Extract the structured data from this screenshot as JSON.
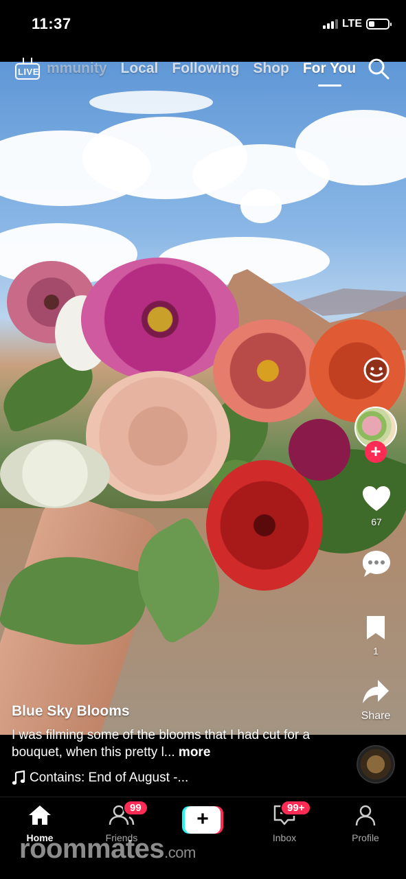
{
  "status_bar": {
    "time": "11:37",
    "network": "LTE"
  },
  "top_nav": {
    "live_label": "LIVE",
    "tabs": [
      {
        "label": "mmunity",
        "active": false
      },
      {
        "label": "Local",
        "active": false
      },
      {
        "label": "Following",
        "active": false
      },
      {
        "label": "Shop",
        "active": false
      },
      {
        "label": "For You",
        "active": true
      }
    ],
    "search_icon": "search-icon"
  },
  "right_rail": {
    "like_count": "67",
    "bookmark_count": "1",
    "share_label": "Share"
  },
  "caption": {
    "username": "Blue Sky Blooms",
    "text": "I was filming some of the blooms that I had cut for a bouquet, when this pretty l...",
    "more_label": "more",
    "sound": "Contains: End of August -..."
  },
  "bottom_nav": {
    "items": [
      {
        "label": "Home",
        "icon": "home-icon",
        "active": true
      },
      {
        "label": "Friends",
        "icon": "friends-icon",
        "badge": "99"
      },
      {
        "label": "",
        "icon": "create-icon"
      },
      {
        "label": "Inbox",
        "icon": "inbox-icon",
        "badge": "99+"
      },
      {
        "label": "Profile",
        "icon": "profile-icon"
      }
    ]
  },
  "watermark": {
    "brand": "roommates",
    "suffix": ".com"
  },
  "colors": {
    "accent": "#fe2c55",
    "cyan": "#25f4ee",
    "background": "#000000"
  }
}
